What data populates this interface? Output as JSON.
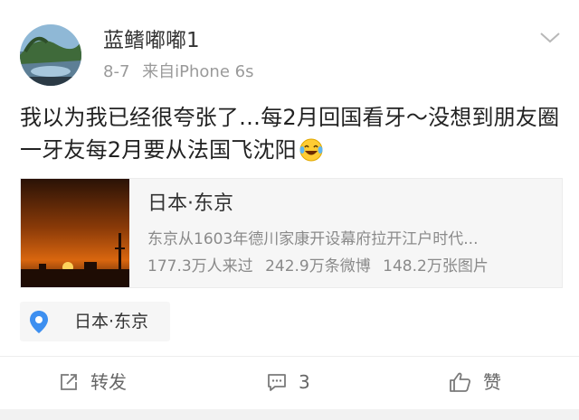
{
  "post": {
    "username": "蓝鳍嘟嘟1",
    "time": "8-7",
    "source": "来自iPhone 6s",
    "text": "我以为我已经很夸张了…每2月回国看牙～没想到朋友圈一牙友每2月要从法国飞沈阳",
    "emoji": "laughing-tears-emoji"
  },
  "location_card": {
    "title": "日本·东京",
    "description": "东京从1603年德川家康开设幕府拉开江户时代...",
    "stats": {
      "visitors": "177.3万人来过",
      "posts": "242.9万条微博",
      "photos": "148.2万张图片"
    }
  },
  "location_tag": {
    "label": "日本·东京"
  },
  "actions": {
    "repost": "转发",
    "comment": "3",
    "like": "赞"
  },
  "colors": {
    "accent_blue": "#3d8ff0",
    "text_primary": "#333333",
    "text_secondary": "#9a9a9a"
  }
}
